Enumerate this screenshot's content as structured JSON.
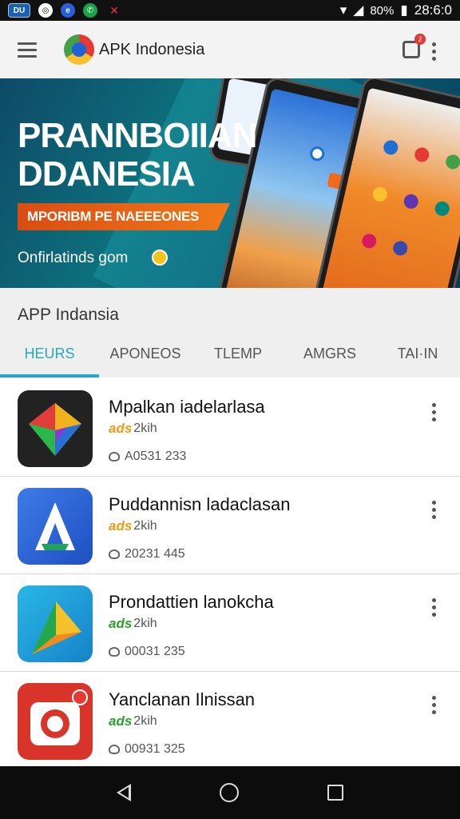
{
  "status_bar": {
    "icons": [
      "du-icon",
      "camera-icon",
      "browser-icon",
      "messenger-icon",
      "news-icon"
    ],
    "du_label": "DU",
    "battery": "80%",
    "time": "28:6:0"
  },
  "app_bar": {
    "title": "APK Indonesia",
    "notification_count": "2"
  },
  "banner": {
    "title_line1": "PRANNBOIIAN",
    "title_line2": "DDANESIA",
    "ribbon": "MPORIBM PE NAEEEONES",
    "subtitle": "Onfirlatinds gom"
  },
  "section": {
    "title": "APP Indansia",
    "tabs": [
      {
        "label": "HEURS",
        "active": true
      },
      {
        "label": "APONEOS",
        "active": false
      },
      {
        "label": "TLEMP",
        "active": false
      },
      {
        "label": "AMGRS",
        "active": false
      },
      {
        "label": "TAI·IN",
        "active": false
      }
    ]
  },
  "apps": [
    {
      "name": "Mpalkan iadelarlasa",
      "badge": "ads",
      "badge_color": "#f29a12",
      "size": "2kih",
      "count": "A0531 233",
      "icon": "diamond-app-icon"
    },
    {
      "name": "Puddannisn ladaclasan",
      "badge": "ads",
      "badge_color": "#f29a12",
      "size": "2kih",
      "count": "20231 445",
      "icon": "letter-a-app-icon"
    },
    {
      "name": "Prondattien lanokcha",
      "badge": "ads",
      "badge_color": "#2aa12a",
      "size": "2kih",
      "count": "00031 235",
      "icon": "triangle-play-app-icon"
    },
    {
      "name": "Yanclanan Ilnissan",
      "badge": "ads",
      "badge_color": "#2aa12a",
      "size": "2kih",
      "count": "00931 325",
      "icon": "camera-app-icon"
    }
  ],
  "colors": {
    "accent": "#25a7c4",
    "banner_bg": "#0d6f7c",
    "ribbon": "#e8651a"
  }
}
